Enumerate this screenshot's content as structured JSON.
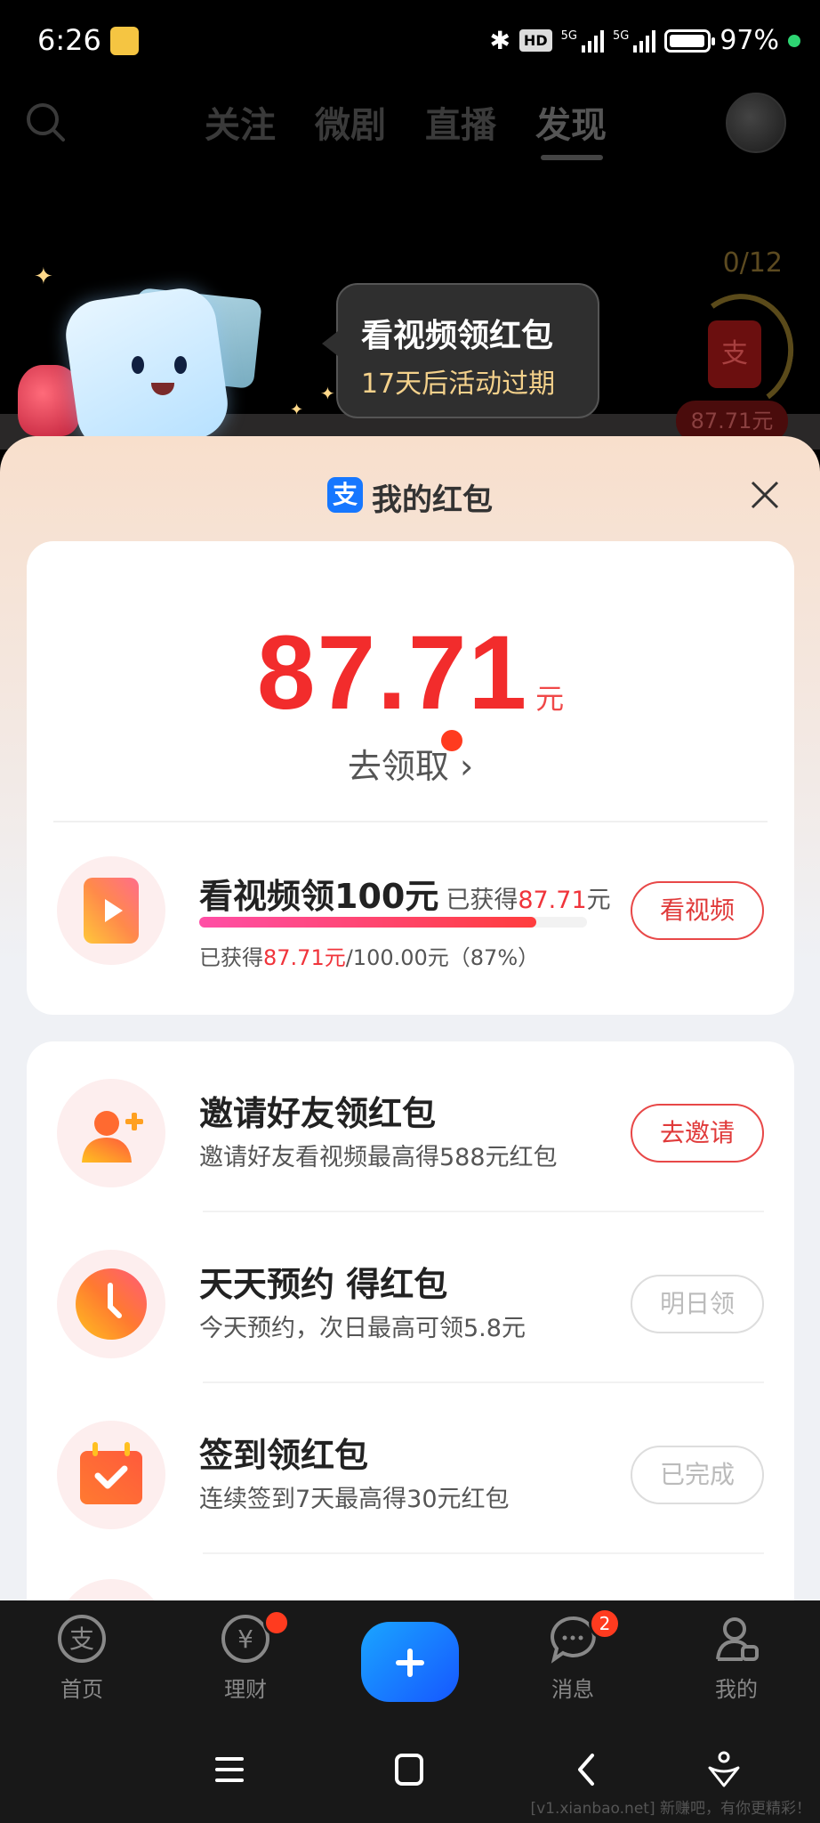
{
  "status_bar": {
    "time": "6:26",
    "network_1": "5G",
    "network_2": "5G",
    "hd_label": "HD",
    "battery_percent": 97,
    "battery_text": "97%"
  },
  "top_nav": {
    "tabs": [
      {
        "label": "关注"
      },
      {
        "label": "微剧"
      },
      {
        "label": "直播"
      },
      {
        "label": "发现",
        "active": true
      }
    ]
  },
  "banner": {
    "bubble_title": "看视频领红包",
    "bubble_subtitle": "17天后活动过期",
    "progress_count": "0/12",
    "packet_logo": "支",
    "packet_amount": "87.71元"
  },
  "sheet": {
    "logo": "支",
    "title": "我的红包",
    "amount": "87.71",
    "amount_unit": "元",
    "claim_label": "去领取",
    "claim_arrow": "›",
    "main_task": {
      "title": "看视频领100元",
      "earned_prefix": "已获得",
      "earned_value": "87.71",
      "earned_unit": "元",
      "progress_fraction": 0.87,
      "detail_prefix": "已获得",
      "detail_value": "87.71元",
      "detail_suffix": "/100.00元（87%）",
      "button": "看视频"
    },
    "tasks": [
      {
        "title": "邀请好友领红包",
        "subtitle": "邀请好友看视频最高得588元红包",
        "button": "去邀请",
        "enabled": true,
        "icon": "user-add-icon"
      },
      {
        "title": "天天预约 得红包",
        "subtitle": "今天预约，次日最高可领5.8元",
        "button": "明日领",
        "enabled": false,
        "icon": "clock-icon"
      },
      {
        "title": "签到领红包",
        "subtitle": "连续签到7天最高得30元红包",
        "button": "已完成",
        "enabled": false,
        "icon": "calendar-check-icon"
      }
    ]
  },
  "tabbar": {
    "items": [
      {
        "label": "首页",
        "icon": "alipay-icon"
      },
      {
        "label": "理财",
        "icon": "yuan-icon",
        "dot": true
      },
      {
        "label": "消息",
        "icon": "chat-icon",
        "badge": "2"
      },
      {
        "label": "我的",
        "icon": "user-icon"
      }
    ]
  },
  "watermark": "[v1.xianbao.net] 新赚吧，有你更精彩！",
  "colors": {
    "accent_red": "#f22c2c",
    "alipay_blue": "#1677ff",
    "badge_red": "#ff3b1f"
  }
}
